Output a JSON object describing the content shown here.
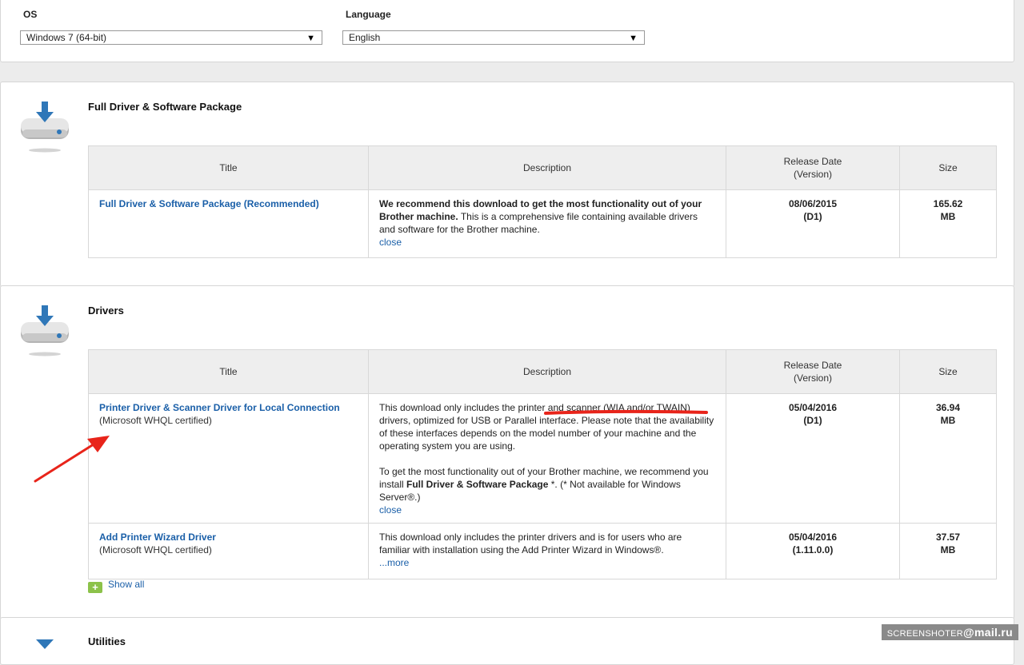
{
  "filters": {
    "os_label": "OS",
    "os_value": "Windows 7 (64-bit)",
    "language_label": "Language",
    "language_value": "English"
  },
  "columns": {
    "title": "Title",
    "description": "Description",
    "release_date": "Release Date",
    "version": "(Version)",
    "size": "Size"
  },
  "full_package": {
    "heading": "Full Driver & Software Package",
    "row": {
      "title": "Full Driver & Software Package (Recommended)",
      "desc_bold": "We recommend this download to get the most functionality out of your Brother machine.",
      "desc_rest": " This is a comprehensive file containing available drivers and software for the Brother machine.",
      "close": "close",
      "date": "08/06/2015",
      "version": "(D1)",
      "size_num": "165.62",
      "size_unit": "MB"
    }
  },
  "drivers": {
    "heading": "Drivers",
    "rows": [
      {
        "title": "Printer Driver & Scanner Driver for Local Connection",
        "subtitle": "(Microsoft WHQL certified)",
        "desc_p1": "This download only includes the printer and scanner (WIA and/or TWAIN) drivers, optimized for USB or Parallel interface. Please note that the availability of these interfaces depends on the model number of your machine and the operating system you are using.",
        "desc_p2a": "To get the most functionality out of your Brother machine, we recommend you install ",
        "desc_p2b": "Full Driver & Software Package",
        "desc_p2c": " *. (* Not available for Windows Server®.)",
        "close": "close",
        "date": "05/04/2016",
        "version": "(D1)",
        "size_num": "36.94",
        "size_unit": "MB"
      },
      {
        "title": "Add Printer Wizard Driver",
        "subtitle": "(Microsoft WHQL certified)",
        "desc": "This download only includes the printer drivers and is for users who are familiar with installation using the Add Printer Wizard in Windows®.",
        "more": "...more",
        "date": "05/04/2016",
        "version": "(1.11.0.0)",
        "size_num": "37.57",
        "size_unit": "MB"
      }
    ],
    "show_all": "Show all"
  },
  "utilities": {
    "heading": "Utilities"
  },
  "watermark": {
    "left": "SCREENSHOTER",
    "right": "@mail.ru"
  },
  "colors": {
    "link": "#1a5fa8",
    "annotation": "#e8241a",
    "show_all_icon": "#8cc24a",
    "download_arrow": "#2f77b8"
  },
  "icons": [
    "download-drive-icon",
    "plus-icon",
    "dropdown-arrow-icon"
  ]
}
